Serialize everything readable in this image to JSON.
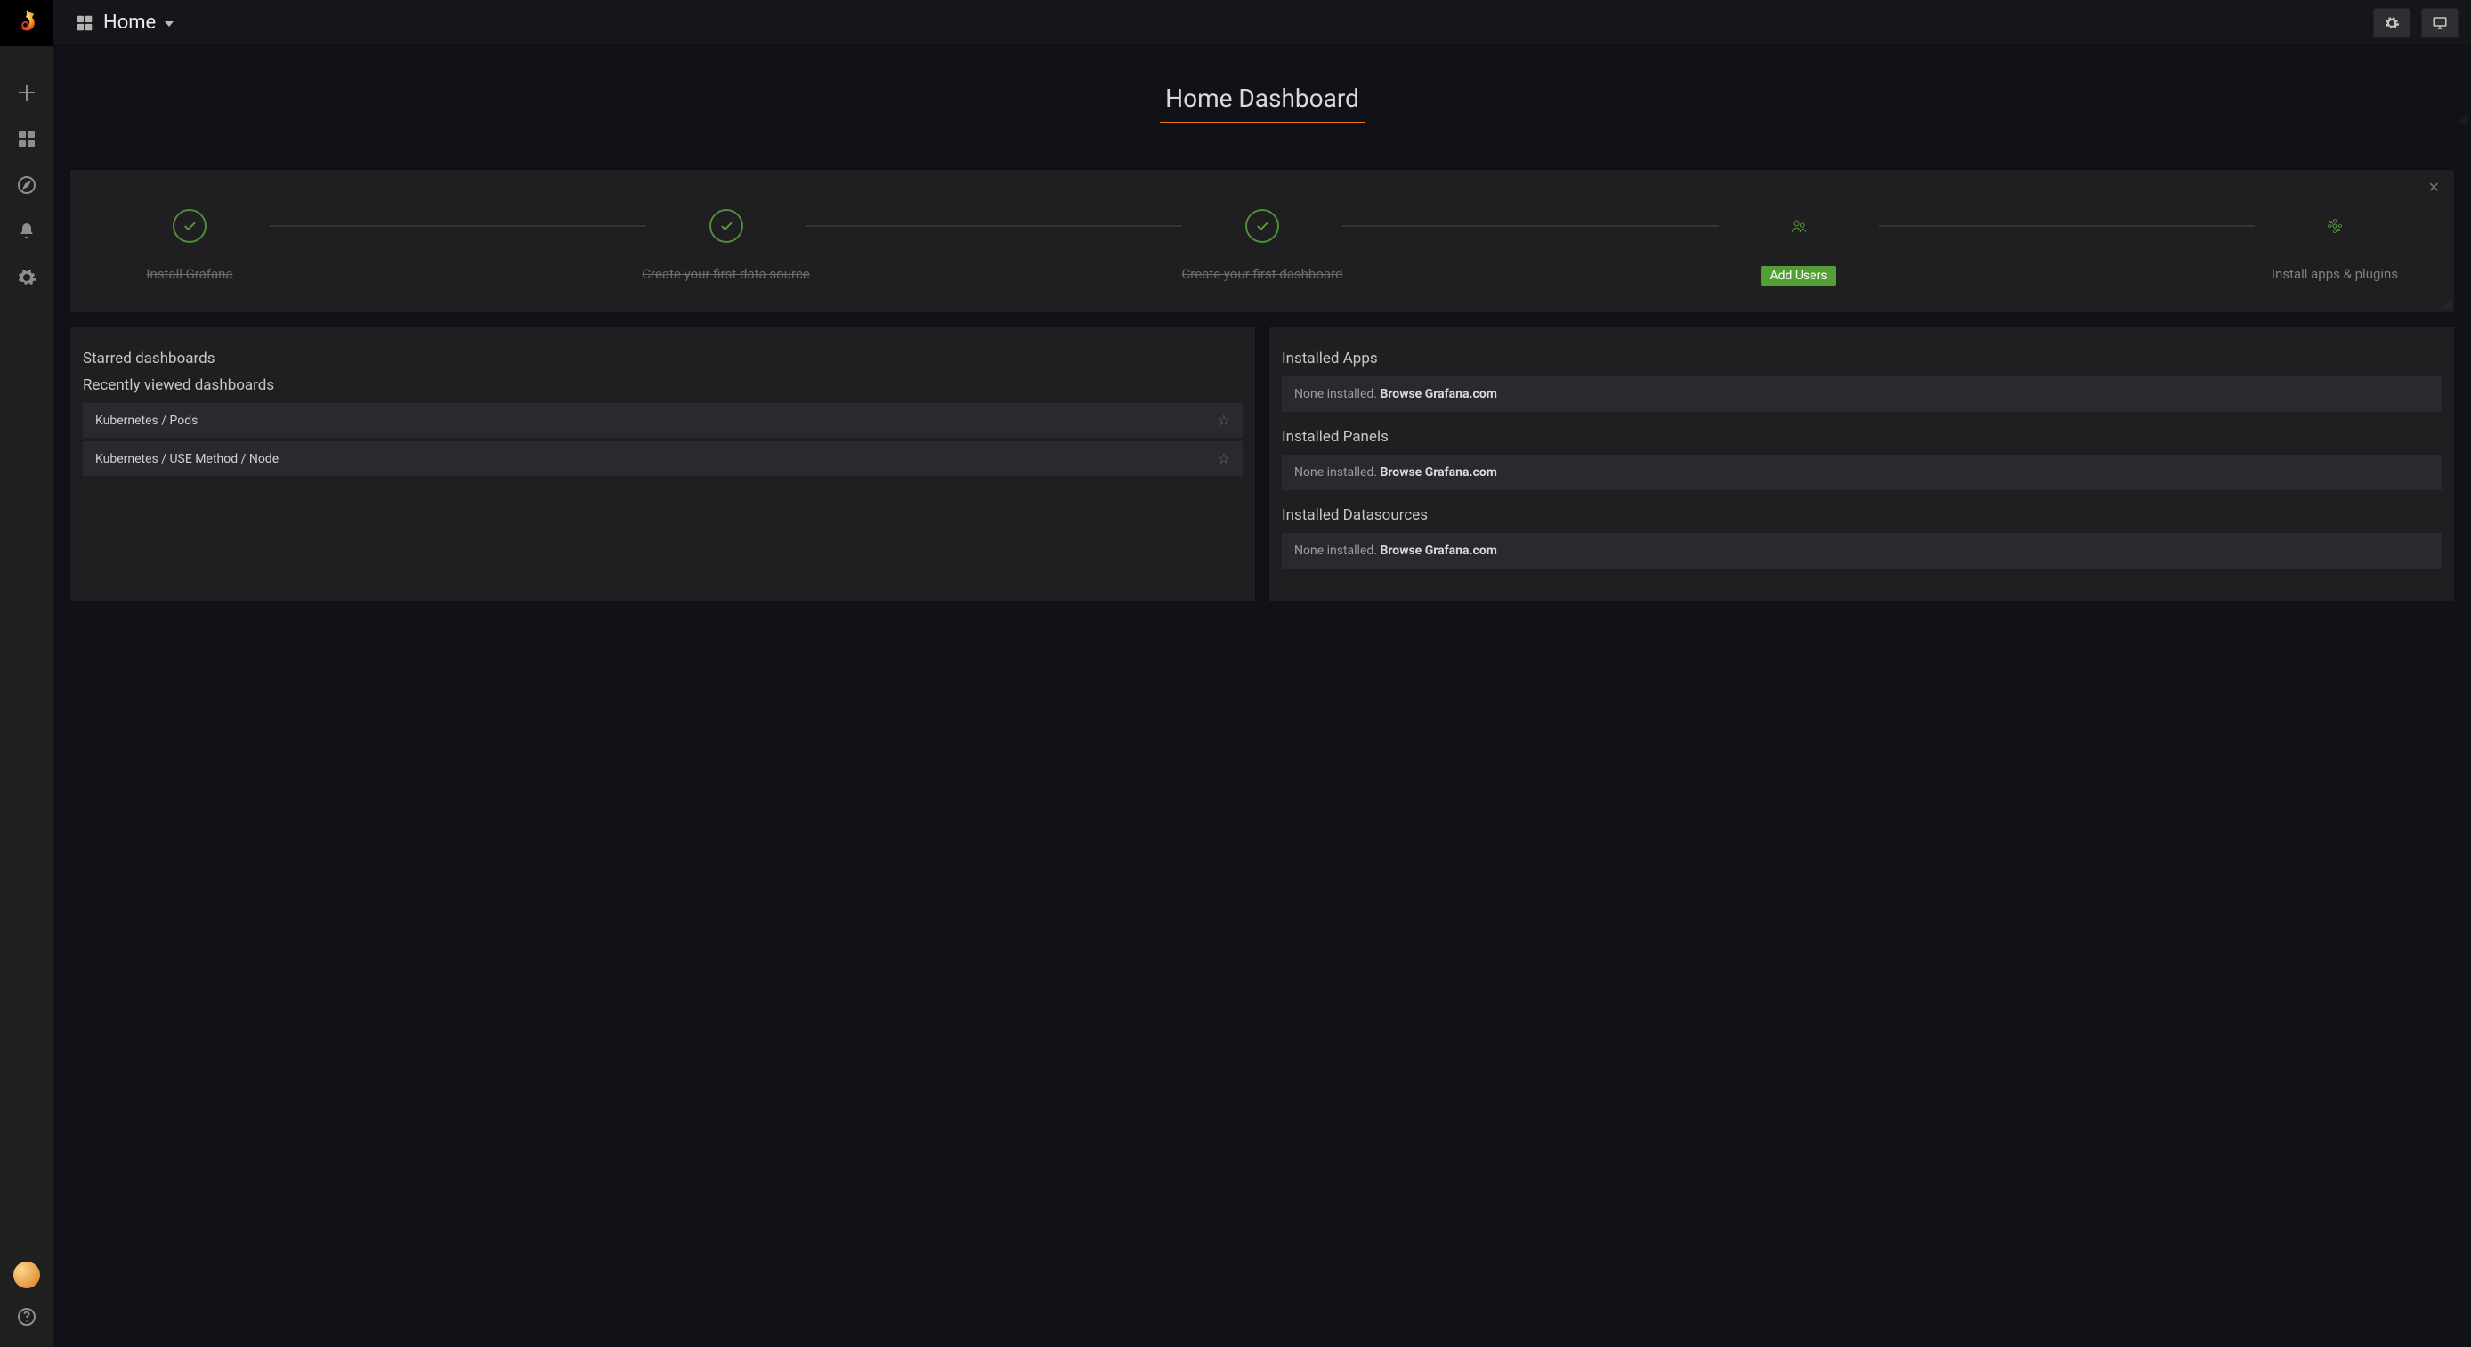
{
  "header": {
    "dropdown_title": "Home"
  },
  "page": {
    "title": "Home Dashboard"
  },
  "getting_started": {
    "steps": [
      {
        "label": "Install Grafana"
      },
      {
        "label": "Create your first data source"
      },
      {
        "label": "Create your first dashboard"
      },
      {
        "label": "Add Users"
      },
      {
        "label": "Install apps & plugins"
      }
    ]
  },
  "left_panel": {
    "starred_title": "Starred dashboards",
    "recent_title": "Recently viewed dashboards",
    "recent": [
      "Kubernetes / Pods",
      "Kubernetes / USE Method / Node"
    ]
  },
  "right_panel": {
    "sections": [
      {
        "title": "Installed Apps",
        "empty_prefix": "None installed. ",
        "link_text": "Browse Grafana.com"
      },
      {
        "title": "Installed Panels",
        "empty_prefix": "None installed. ",
        "link_text": "Browse Grafana.com"
      },
      {
        "title": "Installed Datasources",
        "empty_prefix": "None installed. ",
        "link_text": "Browse Grafana.com"
      }
    ]
  }
}
